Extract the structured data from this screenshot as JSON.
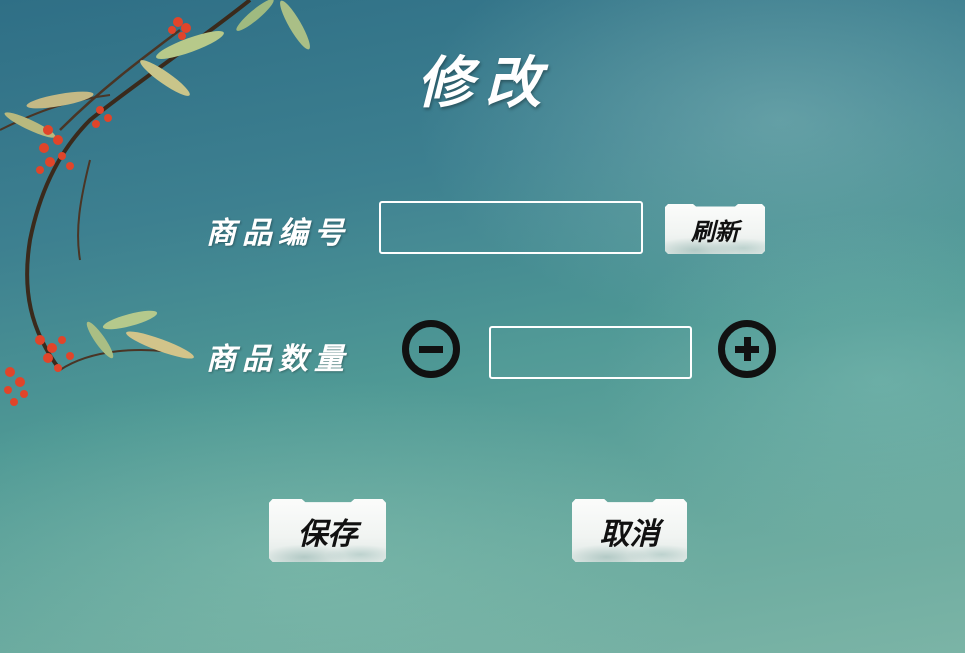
{
  "title": "修改",
  "fields": {
    "product_id_label": "商品编号",
    "product_id_value": "",
    "quantity_label": "商品数量",
    "quantity_value": ""
  },
  "buttons": {
    "refresh": "刷新",
    "decrease_icon": "minus-circle-icon",
    "increase_icon": "plus-circle-icon",
    "save": "保存",
    "cancel": "取消"
  },
  "colors": {
    "background_top": "#2f6f86",
    "background_bottom": "#7bb4a6",
    "text": "#ffffff",
    "button_text": "#111111",
    "berry": "#e0452a"
  }
}
